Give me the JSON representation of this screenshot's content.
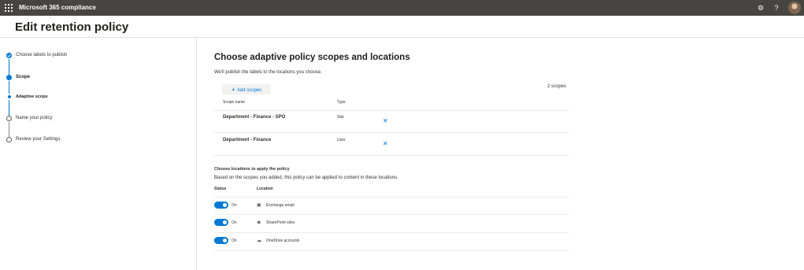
{
  "app": {
    "title": "Microsoft 365 compliance",
    "icons": [
      "waffle-icon",
      "settings-icon",
      "help-icon",
      "avatar"
    ]
  },
  "page": {
    "title": "Edit retention policy"
  },
  "stepper": {
    "steps": [
      {
        "label": "Choose labels to publish",
        "state": "completed"
      },
      {
        "label": "Scope",
        "state": "current"
      },
      {
        "label": "Adaptive scope",
        "state": "current-substep"
      },
      {
        "label": "Name your policy",
        "state": "pending"
      },
      {
        "label": "Review your Settings",
        "state": "pending"
      }
    ]
  },
  "main": {
    "heading": "Choose adaptive policy scopes and locations",
    "description": "We'll publish the labels to the locations you choose.",
    "add_scopes_label": "Add scopes",
    "scope_count": "2 scopes",
    "scopes_table": {
      "headers": [
        "Scope name",
        "Type"
      ],
      "rows": [
        {
          "name": "Department - Finance - SPO",
          "type": "Site"
        },
        {
          "name": "Department - Finance",
          "type": "User"
        }
      ]
    },
    "locations_heading": "Choose locations to apply the policy",
    "locations_description": "Based on the scopes you added, this policy can be applied to content in these locations.",
    "locations_table": {
      "headers": [
        "Status",
        "Location"
      ],
      "rows": [
        {
          "status": "On",
          "location": "Exchange email",
          "icon": "exchange-icon"
        },
        {
          "status": "On",
          "location": "SharePoint sites",
          "icon": "sharepoint-icon"
        },
        {
          "status": "On",
          "location": "OneDrive accounts",
          "icon": "onedrive-icon"
        }
      ]
    }
  },
  "colors": {
    "topbar": "#464542",
    "accent": "#0078d4",
    "divider": "#e1dfdd"
  }
}
